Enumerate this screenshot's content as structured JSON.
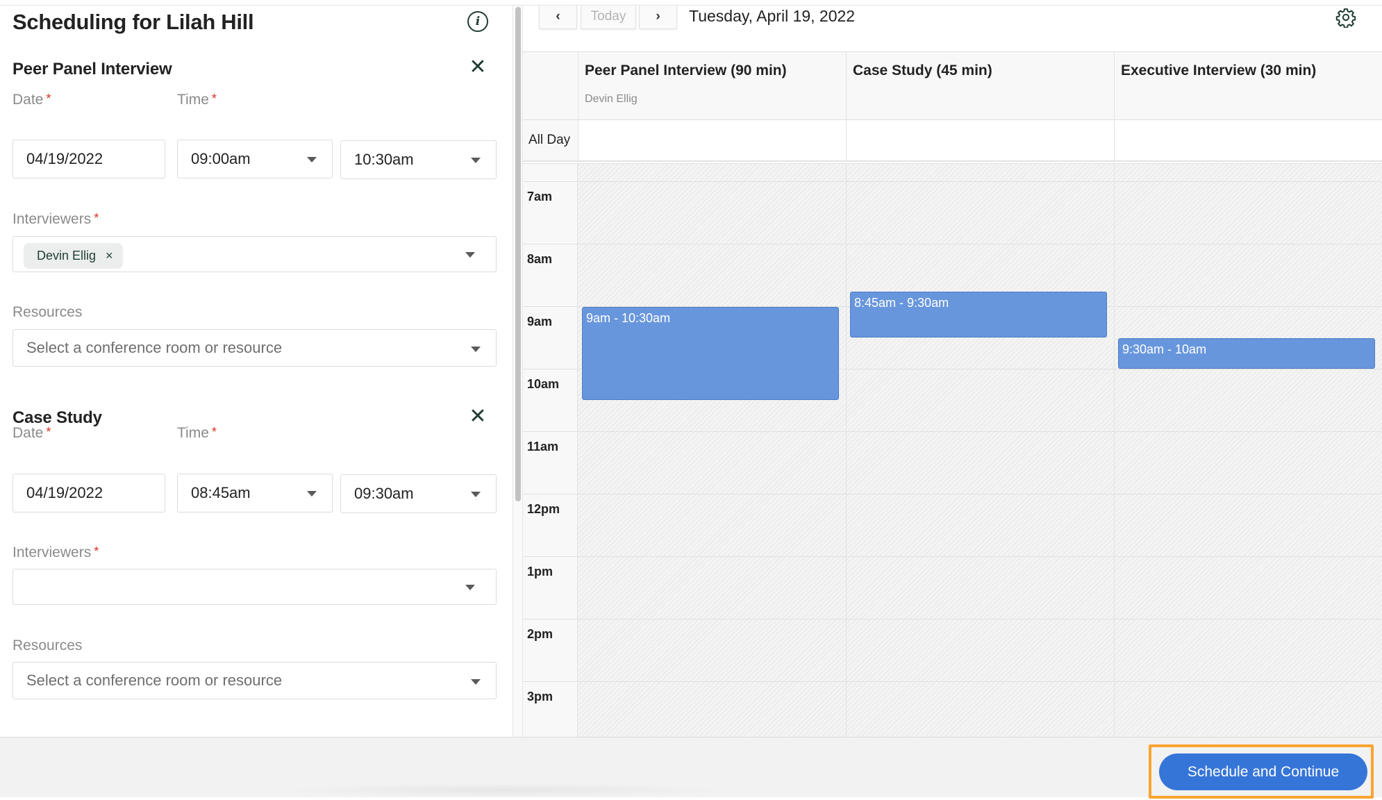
{
  "panel": {
    "title": "Scheduling for Lilah Hill",
    "info_icon": "info-icon",
    "sections": [
      {
        "name": "Peer Panel Interview",
        "date_label": "Date",
        "time_label": "Time",
        "required_marker": "*",
        "date_value": "04/19/2022",
        "start_time": "09:00am",
        "end_time": "10:30am",
        "interviewers_label": "Interviewers",
        "interviewers": [
          "Devin Ellig"
        ],
        "chip_remove_icon": "×",
        "resources_label": "Resources",
        "resources_placeholder": "Select a conference room or resource",
        "close_icon": "✕"
      },
      {
        "name": "Case Study",
        "date_label": "Date",
        "time_label": "Time",
        "required_marker": "*",
        "date_value": "04/19/2022",
        "start_time": "08:45am",
        "end_time": "09:30am",
        "interviewers_label": "Interviewers",
        "interviewers": [],
        "resources_label": "Resources",
        "resources_placeholder": "Select a conference room or resource",
        "close_icon": "✕"
      }
    ]
  },
  "calendar": {
    "nav": {
      "prev": "‹",
      "today": "Today",
      "next": "›"
    },
    "date": "Tuesday, April 19, 2022",
    "settings_icon": "gear-icon",
    "all_day_label": "All Day",
    "columns": [
      {
        "name": "Peer Panel Interview (90 min)",
        "interviewer": "Devin Ellig"
      },
      {
        "name": "Case Study (45 min)",
        "interviewer": ""
      },
      {
        "name": "Executive Interview (30 min)",
        "interviewer": ""
      }
    ],
    "hours": [
      "7am",
      "8am",
      "9am",
      "10am",
      "11am",
      "12pm",
      "1pm",
      "2pm",
      "3pm"
    ],
    "events": [
      {
        "column": 0,
        "label": "9am - 10:30am",
        "start": 9.0,
        "end": 10.5
      },
      {
        "column": 1,
        "label": "8:45am - 9:30am",
        "start": 8.75,
        "end": 9.5
      },
      {
        "column": 2,
        "label": "9:30am - 10am",
        "start": 9.5,
        "end": 10.0
      }
    ],
    "event_color": "#6896dd"
  },
  "footer": {
    "primary_button": "Schedule and Continue",
    "primary_color": "#3675d8",
    "highlight_color": "#f9a431"
  }
}
